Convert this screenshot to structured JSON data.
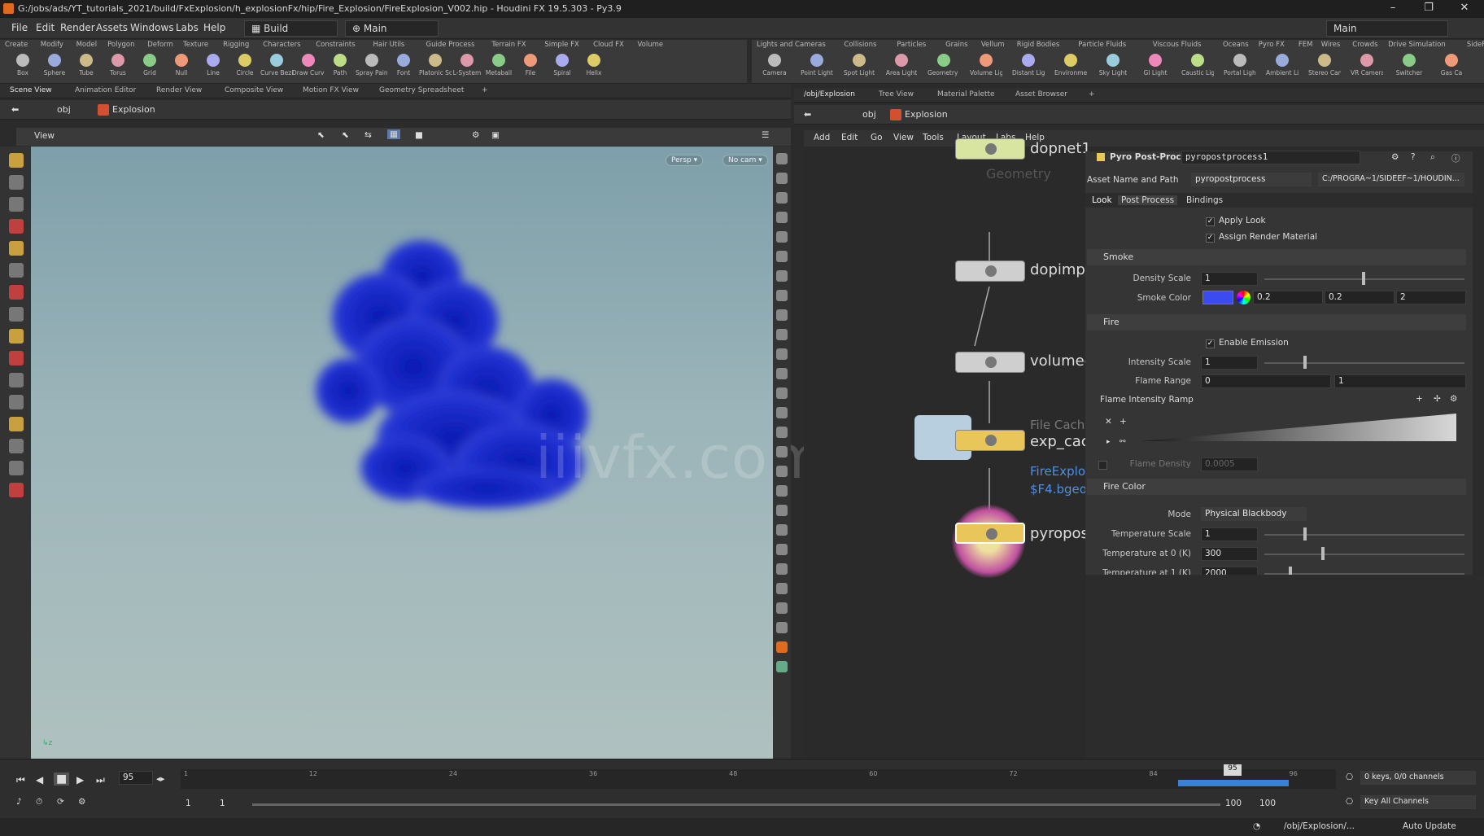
{
  "window": {
    "title": "G:/jobs/ads/YT_tutorials_2021/build/FxExplosion/h_explosionFx/hip/Fire_Explosion/FireExplosion_V002.hip - Houdini FX 19.5.303 - Py3.9",
    "minimize": "–",
    "maximize": "❐",
    "close": "✕"
  },
  "menubar": {
    "items": [
      "File",
      "Edit",
      "Render",
      "Assets",
      "Windows",
      "Labs",
      "Help"
    ],
    "desktop": "Build",
    "context": "Main",
    "right_desktop": "Main"
  },
  "shelf_left": {
    "tabs": [
      "Create",
      "Modify",
      "Model",
      "Polygon",
      "Deform",
      "Texture",
      "Rigging",
      "Characters",
      "Constraints",
      "Hair Utils",
      "Guide Process",
      "Terrain FX",
      "Simple FX",
      "Cloud FX",
      "Volume"
    ],
    "tools": [
      "Box",
      "Sphere",
      "Tube",
      "Torus",
      "Grid",
      "Null",
      "Line",
      "Circle",
      "Curve Bezier",
      "Draw Curve",
      "Path",
      "Spray Paint",
      "Font",
      "Platonic Solids",
      "L-System",
      "Metaball",
      "File",
      "Spiral",
      "Helix"
    ]
  },
  "shelf_right": {
    "tabs": [
      "Lights and Cameras",
      "Collisions",
      "Particles",
      "Grains",
      "Vellum",
      "Rigid Bodies",
      "Particle Fluids",
      "Viscous Fluids",
      "Oceans",
      "Pyro FX",
      "FEM",
      "Wires",
      "Crowds",
      "Drive Simulation",
      "SideFX Labs"
    ],
    "tools": [
      "Camera",
      "Point Light",
      "Spot Light",
      "Area Light",
      "Geometry Light",
      "Volume Light",
      "Distant Light",
      "Environment Light",
      "Sky Light",
      "GI Light",
      "Caustic Light",
      "Portal Light",
      "Ambient Light",
      "Stereo Camera",
      "VR Camera",
      "Switcher",
      "Gas Ca"
    ]
  },
  "left_pane": {
    "tabs": [
      "Scene View",
      "Animation Editor",
      "Render View",
      "Composite View",
      "Motion FX View",
      "Geometry Spreadsheet"
    ],
    "path": [
      "obj",
      "Explosion"
    ],
    "view_label": "View",
    "persp": "Persp ▾",
    "cam": "No cam ▾",
    "watermark": "iiivfx.com"
  },
  "right_pane": {
    "tabs": [
      "/obj/Explosion",
      "Tree View",
      "Material Palette",
      "Asset Browser"
    ],
    "path": [
      "obj",
      "Explosion"
    ],
    "menu": [
      "Add",
      "Edit",
      "Go",
      "View",
      "Tools",
      "Layout",
      "Labs",
      "Help"
    ]
  },
  "network": {
    "nodes": [
      {
        "label": "dopnet1",
        "sub": "Geometry"
      },
      {
        "label": "dopimpo"
      },
      {
        "label": "volumec"
      },
      {
        "label": "exp_cac",
        "sub": "File Cache",
        "extra1": "FireExplo",
        "extra2": "$F4.bgeo."
      },
      {
        "label": "pyropos"
      }
    ]
  },
  "parms": {
    "node_type": "Pyro Post-Process",
    "node_name": "pyropostprocess1",
    "asset_label": "Asset Name and Path",
    "asset_name": "pyropostprocess",
    "asset_path": "C:/PROGRA~1/SIDEEF~1/HOUDIN...",
    "tabs": [
      "Look",
      "Post Process",
      "Bindings"
    ],
    "apply_look": "Apply Look",
    "assign_material": "Assign Render Material",
    "smoke_section": "Smoke",
    "density_scale_label": "Density Scale",
    "density_scale": "1",
    "smoke_color_label": "Smoke Color",
    "smoke_color": [
      "0.2",
      "0.2",
      "2"
    ],
    "smoke_swatch": "#3a4cf0",
    "fire_section": "Fire",
    "enable_emission": "Enable Emission",
    "intensity_label": "Intensity Scale",
    "intensity": "1",
    "flame_range_label": "Flame Range",
    "flame_range": [
      "0",
      "1"
    ],
    "ramp_label": "Flame Intensity Ramp",
    "flame_density_label": "Flame Density",
    "flame_density": "0.0005",
    "fire_color_section": "Fire Color",
    "mode_label": "Mode",
    "mode": "Physical Blackbody",
    "temp_scale_label": "Temperature Scale",
    "temp_scale": "1",
    "temp0_label": "Temperature at 0 (K)",
    "temp0": "300",
    "temp1_label": "Temperature at 1 (K)",
    "temp1": "2000"
  },
  "timeline": {
    "current_frame": "95",
    "ticks": [
      "1",
      "12",
      "24",
      "36",
      "48",
      "60",
      "72",
      "84",
      "96"
    ],
    "range_start": "1",
    "range_start2": "1",
    "range_end": "100",
    "range_end2": "100",
    "keys_info": "0 keys, 0/0 channels",
    "key_all": "Key All Channels",
    "status_path": "/obj/Explosion/...",
    "auto_update": "Auto Update",
    "marker": "95"
  },
  "colors": {
    "smoke_blue": "#1a2ec8",
    "accent_blue": "#3b7fd8",
    "node_yellow": "#e8c65a"
  }
}
